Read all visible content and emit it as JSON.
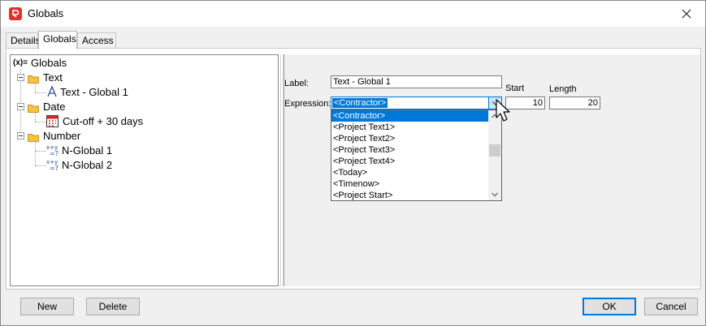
{
  "window": {
    "title": "Globals"
  },
  "tabs": [
    {
      "label": "Details",
      "active": false
    },
    {
      "label": "Globals",
      "active": true
    },
    {
      "label": "Access",
      "active": false
    }
  ],
  "tree": {
    "root": {
      "label": "Globals",
      "icon": "variable-icon"
    },
    "groups": [
      {
        "label": "Text",
        "icon": "folder-icon",
        "items": [
          {
            "label": "Text - Global 1",
            "icon": "text-a-icon"
          }
        ]
      },
      {
        "label": "Date",
        "icon": "folder-icon",
        "items": [
          {
            "label": "Cut-off + 30 days",
            "icon": "calendar-icon"
          }
        ]
      },
      {
        "label": "Number",
        "icon": "folder-icon",
        "items": [
          {
            "label": "N-Global 1",
            "icon": "number-formula-icon"
          },
          {
            "label": "N-Global 2",
            "icon": "number-formula-icon"
          }
        ]
      }
    ]
  },
  "form": {
    "label_caption": "Label:",
    "label_value": "Text - Global 1",
    "expression_caption": "Expression:",
    "expression_value": "<Contractor>",
    "start_caption": "Start",
    "start_value": "10",
    "length_caption": "Length",
    "length_value": "20"
  },
  "dropdown": {
    "options": [
      {
        "label": "<Contractor>",
        "selected": true
      },
      {
        "label": "<Project Text1>",
        "selected": false
      },
      {
        "label": "<Project Text2>",
        "selected": false
      },
      {
        "label": "<Project Text3>",
        "selected": false
      },
      {
        "label": "<Project Text4>",
        "selected": false
      },
      {
        "label": "<Today>",
        "selected": false
      },
      {
        "label": "<Timenow>",
        "selected": false
      },
      {
        "label": "<Project Start>",
        "selected": false
      }
    ]
  },
  "buttons": {
    "new": "New",
    "delete": "Delete",
    "ok": "OK",
    "cancel": "Cancel"
  },
  "colors": {
    "accent": "#0078d7",
    "brand": "#e0312c",
    "folder": "#f5c242"
  }
}
